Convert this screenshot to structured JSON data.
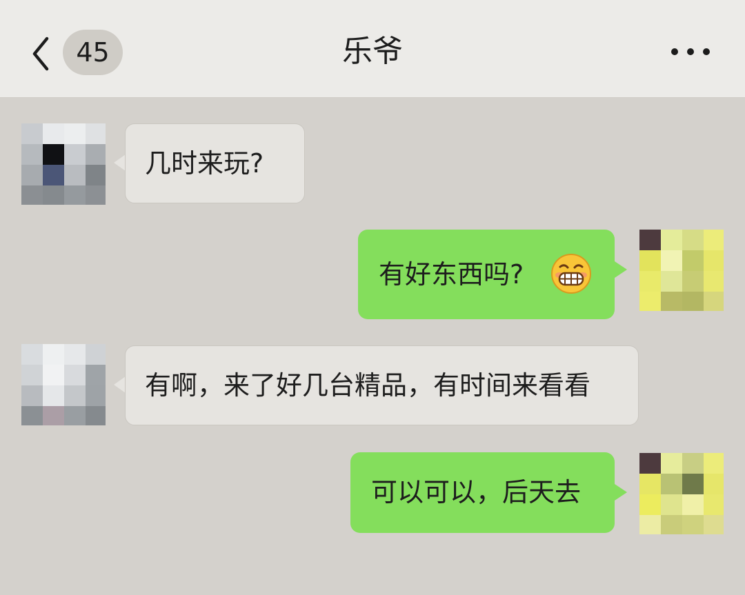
{
  "header": {
    "unread_count": "45",
    "title": "乐爷"
  },
  "icons": {
    "back": "chevron-left-icon",
    "more": "more-dots-icon",
    "emoji": "grinning-face-emoji-icon"
  },
  "colors": {
    "chat_background": "#d4d1cc",
    "header_background": "#ecebe8",
    "incoming_bubble": "#e6e4e0",
    "outgoing_bubble": "#84de5c"
  },
  "messages": [
    {
      "side": "left",
      "text": "几时来玩?"
    },
    {
      "side": "right",
      "text": "有好东西吗?",
      "emoji": "grinning-face"
    },
    {
      "side": "left",
      "text": "有啊，来了好几台精品，有时间来看看"
    },
    {
      "side": "right",
      "text": "可以可以，后天去"
    }
  ]
}
